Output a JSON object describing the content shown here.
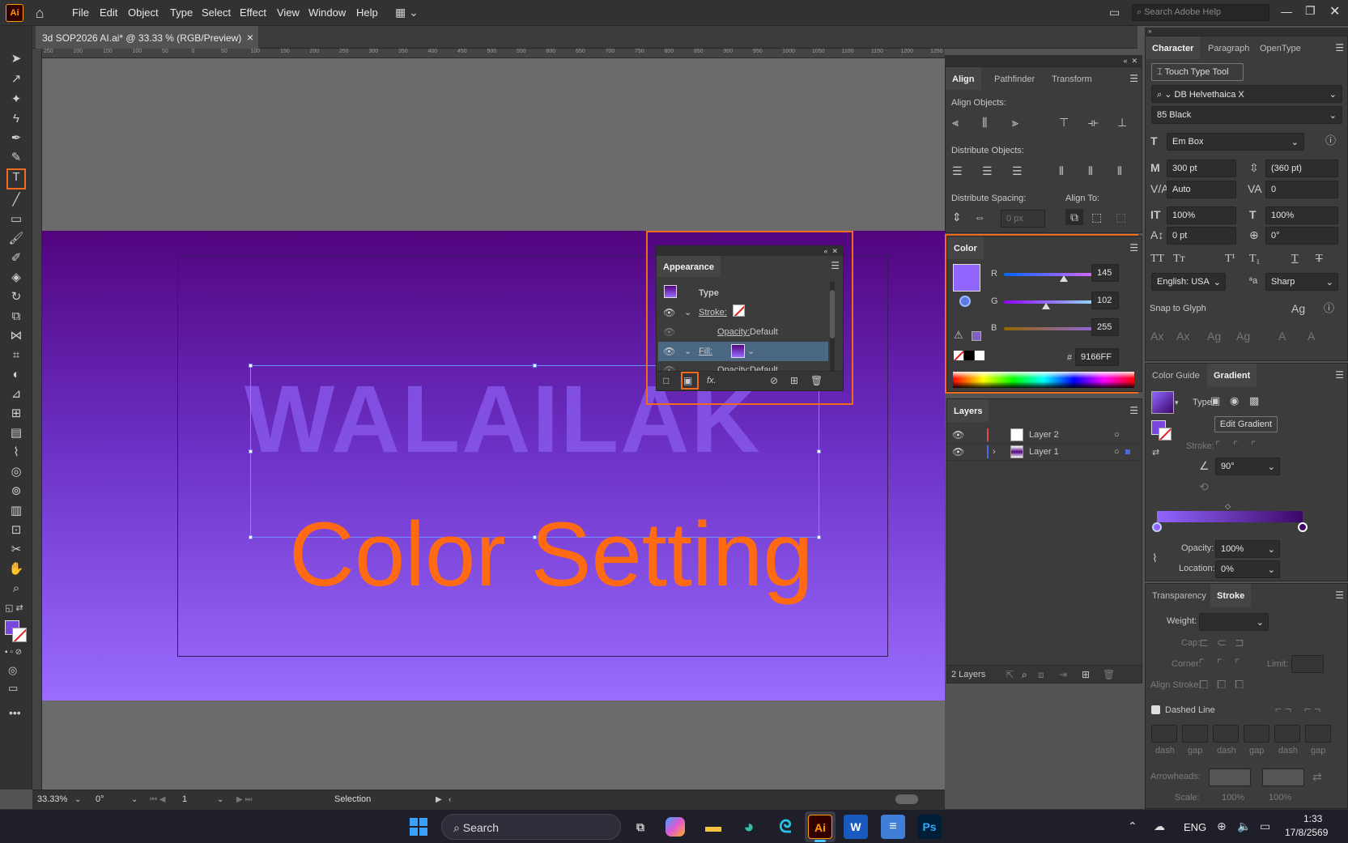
{
  "app": {
    "logo": "Ai",
    "accent": "#f26b1d"
  },
  "menubar": {
    "items": [
      "File",
      "Edit",
      "Object",
      "Type",
      "Select",
      "Effect",
      "View",
      "Window",
      "Help"
    ],
    "search_placeholder": "Search Adobe Help"
  },
  "document": {
    "tab_title": "3d SOP2026 AI.ai* @ 33.33 % (RGB/Preview)",
    "close": "×"
  },
  "ruler": {
    "ticks": [
      "250",
      "200",
      "150",
      "100",
      "50",
      "0",
      "50",
      "100",
      "150",
      "200",
      "250",
      "300",
      "350",
      "400",
      "450",
      "500",
      "550",
      "600",
      "650",
      "700",
      "750",
      "800",
      "850",
      "900",
      "950",
      "1000",
      "1050",
      "1100",
      "1150",
      "1200",
      "1250"
    ]
  },
  "artwork": {
    "main_text": "WALAILAK",
    "overlay_text": "Color Setting",
    "gradient": [
      "#52047e",
      "#6b2fc3",
      "#9a6cff"
    ]
  },
  "align_panel": {
    "tabs": [
      "Align",
      "Pathfinder",
      "Transform"
    ],
    "align_objects": "Align Objects:",
    "distribute_objects": "Distribute Objects:",
    "distribute_spacing": "Distribute Spacing:",
    "align_to": "Align To:",
    "spacing_value": "0 px"
  },
  "color_panel": {
    "tab": "Color",
    "r_label": "R",
    "g_label": "G",
    "b_label": "B",
    "r": 145,
    "g": 102,
    "b": 255,
    "hex_label": "#",
    "hex": "9166FF",
    "swatch": "#9166ff"
  },
  "appearance_panel": {
    "title": "Appearance",
    "type_label": "Type",
    "stroke_label": "Stroke:",
    "opacity_label": "Opacity:",
    "opacity_value": "Default",
    "fill_label": "Fill:",
    "opacity2_label": "Opacity:",
    "opacity2_value": "Default",
    "fx": "fx."
  },
  "layers_panel": {
    "tab": "Layers",
    "layers": [
      {
        "name": "Layer 2",
        "color": "#e04a4a"
      },
      {
        "name": "Layer 1",
        "color": "#4a6ae0"
      }
    ],
    "count": "2 Layers"
  },
  "character_panel": {
    "tabs": [
      "Character",
      "Paragraph",
      "OpenType"
    ],
    "touch_type": "Touch Type Tool",
    "font_family": "DB Helvethaica X",
    "font_style": "85 Black",
    "em_box": "Em Box",
    "font_size": "300 pt",
    "leading": "(360 pt)",
    "kerning": "Auto",
    "tracking": "0",
    "vert_scale": "100%",
    "horiz_scale": "100%",
    "baseline": "0 pt",
    "rotation": "0°",
    "language": "English: USA",
    "aa_label": "ªa",
    "antialias": "Sharp",
    "snap_to_glyph": "Snap to Glyph"
  },
  "gradient_panel": {
    "tabs": [
      "Color Guide",
      "Gradient"
    ],
    "type_label": "Type:",
    "edit_button": "Edit Gradient",
    "stroke_label": "Stroke:",
    "angle": "90°",
    "opacity_label": "Opacity:",
    "opacity": "100%",
    "location_label": "Location:",
    "location": "0%",
    "start": "#9166ff",
    "end": "#3d0868"
  },
  "stroke_panel": {
    "tabs": [
      "Transparency",
      "Stroke"
    ],
    "weight_label": "Weight:",
    "cap_label": "Cap:",
    "corner_label": "Corner:",
    "limit_label": "Limit:",
    "align_label": "Align Stroke:",
    "dashed_label": "Dashed Line",
    "dash_labels": [
      "dash",
      "gap",
      "dash",
      "gap",
      "dash",
      "gap"
    ],
    "arrowheads_label": "Arrowheads:",
    "scale_label": "Scale:",
    "scale_values": [
      "100%",
      "100%"
    ]
  },
  "statusbar": {
    "zoom": "33.33%",
    "rotate": "0°",
    "artboard": "1",
    "tool": "Selection"
  },
  "taskbar": {
    "search": "Search",
    "lang": "ENG",
    "time": "1:33",
    "date": "17/8/2569",
    "apps": [
      "Ai",
      "W",
      "Ps"
    ]
  }
}
